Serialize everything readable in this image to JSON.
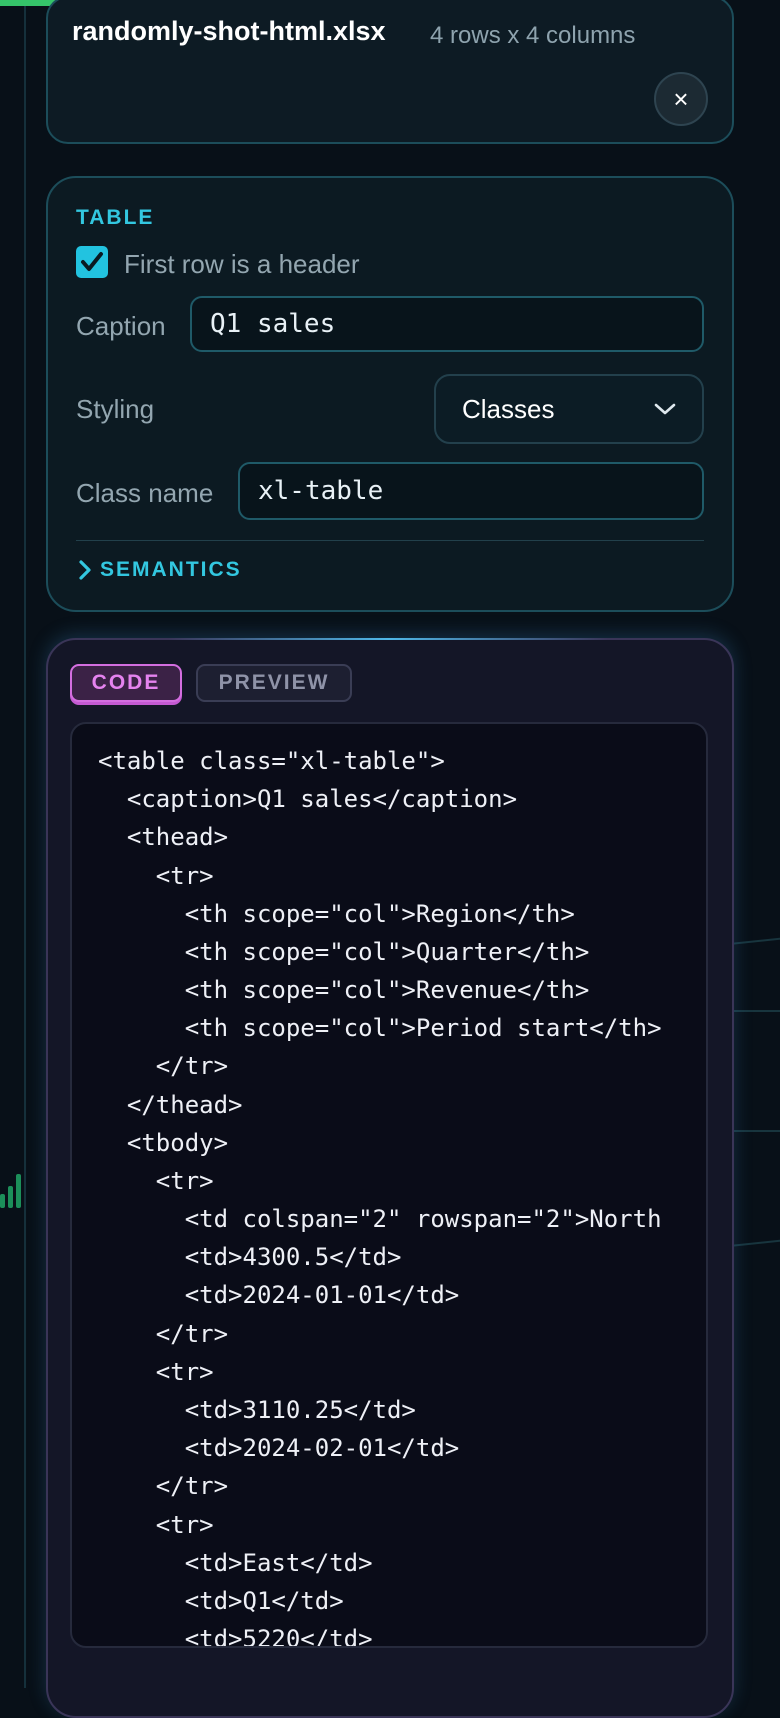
{
  "file": {
    "name": "randomly-shot-html.xlsx",
    "meta": "4 rows x 4 columns",
    "close_icon": "×"
  },
  "table_settings": {
    "section_label": "TABLE",
    "header_checkbox": {
      "label": "First row is a header",
      "checked": true
    },
    "caption": {
      "label": "Caption",
      "value": "Q1 sales"
    },
    "styling": {
      "label": "Styling",
      "selected": "Classes"
    },
    "class_name": {
      "label": "Class name",
      "value": "xl-table"
    },
    "semantics": {
      "label": "SEMANTICS",
      "expanded": false
    }
  },
  "output": {
    "tabs": [
      {
        "label": "CODE",
        "active": true
      },
      {
        "label": "PREVIEW",
        "active": false
      }
    ],
    "code_lines": [
      "<table class=\"xl-table\">",
      "  <caption>Q1 sales</caption>",
      "  <thead>",
      "    <tr>",
      "      <th scope=\"col\">Region</th>",
      "      <th scope=\"col\">Quarter</th>",
      "      <th scope=\"col\">Revenue</th>",
      "      <th scope=\"col\">Period start</th>",
      "    </tr>",
      "  </thead>",
      "  <tbody>",
      "    <tr>",
      "      <td colspan=\"2\" rowspan=\"2\">North",
      "      <td>4300.5</td>",
      "      <td>2024-01-01</td>",
      "    </tr>",
      "    <tr>",
      "      <td>3110.25</td>",
      "      <td>2024-02-01</td>",
      "    </tr>",
      "    <tr>",
      "      <td>East</td>",
      "      <td>Q1</td>",
      "      <td>5220</td>"
    ]
  },
  "colors": {
    "accent_cyan": "#33c7e0",
    "accent_magenta": "#e583ef",
    "background": "#081018"
  }
}
